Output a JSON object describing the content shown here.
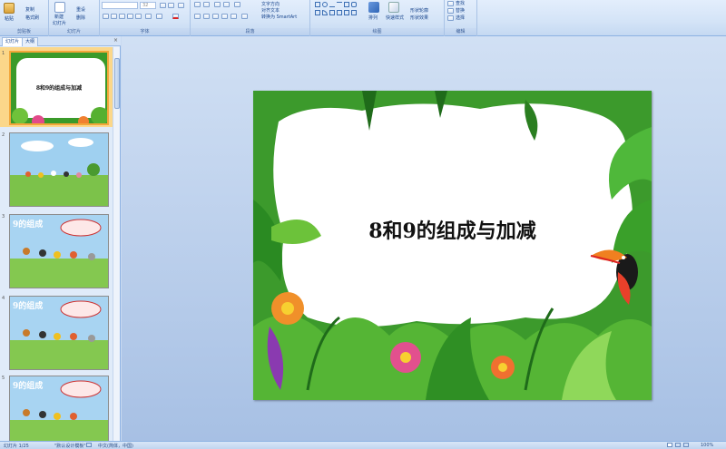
{
  "ribbon": {
    "clipboard": {
      "paste": "粘贴",
      "copy": "复制",
      "format_painter": "格式刷",
      "label": "剪贴板"
    },
    "slides": {
      "new_slide": "新建",
      "new_slide_sub": "幻灯片",
      "reset": "重设",
      "delete": "删除",
      "label": "幻灯片"
    },
    "font": {
      "size": "32",
      "label": "字体"
    },
    "paragraph": {
      "text_dir": "文字方向",
      "align_text": "对齐文本",
      "smartart": "转换为 SmartArt",
      "label": "段落"
    },
    "drawing": {
      "arrange": "排列",
      "quick_styles": "快速样式",
      "shape_outline": "形状轮廓",
      "shape_effects": "形状效果",
      "label": "绘图"
    },
    "editing": {
      "find": "查找",
      "replace": "替换",
      "select": "选择",
      "label": "编辑"
    }
  },
  "pane": {
    "tab_slides": "幻灯片",
    "tab_outline": "大纲",
    "close": "×",
    "thumbnails": [
      {
        "num": "1",
        "title": "8和9的组成与加减"
      },
      {
        "num": "2",
        "title": ""
      },
      {
        "num": "3",
        "title": "9的组成"
      },
      {
        "num": "4",
        "title": "9的组成"
      },
      {
        "num": "5",
        "title": "9的组成"
      }
    ]
  },
  "slide": {
    "title": "8和9的组成与加减"
  },
  "status": {
    "slide_info": "幻灯片 1/25",
    "theme": "\"默认设计模板\"",
    "language": "中文(简体，中国)",
    "zoom": "100%"
  },
  "colors": {
    "selected_thumb": "#f3a63a",
    "jungle_green": "#2e8b2e",
    "ribbon_bg": "#d4e4f7"
  }
}
